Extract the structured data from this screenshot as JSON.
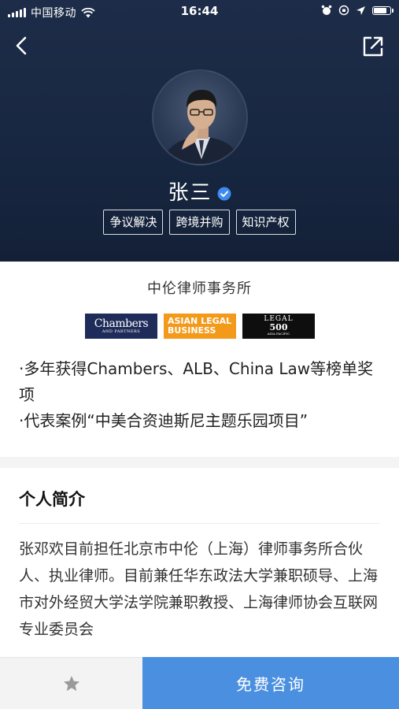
{
  "status_bar": {
    "carrier": "中国移动",
    "time": "16:44"
  },
  "profile": {
    "name": "张三",
    "tags": [
      "争议解决",
      "跨境并购",
      "知识产权"
    ]
  },
  "firm": {
    "name": "中伦律师事务所",
    "logos": {
      "chambers_line1": "Chambers",
      "chambers_line2": "AND PARTNERS",
      "alb_line1": "ASIAN LEGAL",
      "alb_line2": "BUSINESS",
      "legal500_line1": "LEGAL",
      "legal500_line2": "500",
      "legal500_line3": "ASIA PACIFIC"
    },
    "highlights": [
      "·多年获得Chambers、ALB、China Law等榜单奖项",
      "·代表案例“中美合资迪斯尼主题乐园项目”"
    ]
  },
  "intro": {
    "title": "个人简介",
    "text": "张邓欢目前担任北京市中伦（上海）律师事务所合伙人、执业律师。目前兼任华东政法大学兼职硕导、上海市对外经贸大学法学院兼职教授、上海律师协会互联网专业委员会"
  },
  "bottom_bar": {
    "consult_label": "免费咨询"
  },
  "colors": {
    "header_bg": "#1a2a45",
    "primary_button": "#4b90e0",
    "alb_orange": "#f39a1b",
    "chambers_navy": "#1f2c5a",
    "verified_blue": "#3d8bf0"
  },
  "icons": [
    "signal-icon",
    "wifi-icon",
    "alarm-icon",
    "location-icon",
    "battery-icon",
    "back-arrow-icon",
    "share-icon",
    "verified-icon",
    "star-icon"
  ]
}
